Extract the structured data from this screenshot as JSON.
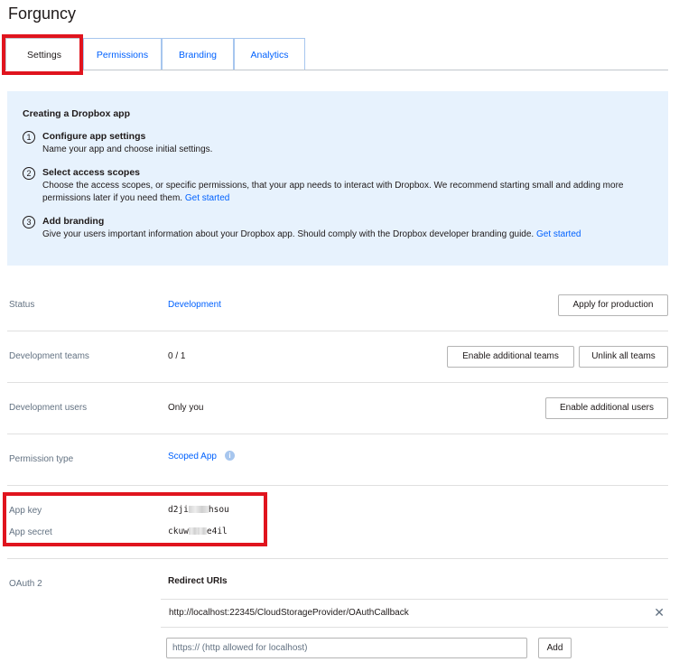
{
  "app": {
    "title": "Forguncy"
  },
  "tabs": [
    {
      "label": "Settings",
      "active": true
    },
    {
      "label": "Permissions",
      "active": false
    },
    {
      "label": "Branding",
      "active": false
    },
    {
      "label": "Analytics",
      "active": false
    }
  ],
  "info": {
    "title": "Creating a Dropbox app",
    "steps": [
      {
        "num": "1",
        "heading": "Configure app settings",
        "text": "Name your app and choose initial settings.",
        "link": ""
      },
      {
        "num": "2",
        "heading": "Select access scopes",
        "text": "Choose the access scopes, or specific permissions, that your app needs to interact with Dropbox. We recommend starting small and adding more permissions later if you need them.",
        "link": "Get started"
      },
      {
        "num": "3",
        "heading": "Add branding",
        "text": "Give your users important information about your Dropbox app. Should comply with the Dropbox developer branding guide.",
        "link": "Get started"
      }
    ]
  },
  "settings": {
    "status": {
      "label": "Status",
      "value": "Development",
      "button": "Apply for production"
    },
    "dev_teams": {
      "label": "Development teams",
      "value": "0 / 1",
      "button_enable": "Enable additional teams",
      "button_unlink": "Unlink all teams"
    },
    "dev_users": {
      "label": "Development users",
      "value": "Only you",
      "button": "Enable additional users"
    },
    "permission_type": {
      "label": "Permission type",
      "value": "Scoped App",
      "icon": "info-icon"
    },
    "app_key": {
      "label": "App key",
      "prefix": "d2ji",
      "suffix": "hsou"
    },
    "app_secret": {
      "label": "App secret",
      "prefix": "ckuw",
      "suffix": "e4il"
    },
    "oauth": {
      "label": "OAuth 2",
      "redirect_title": "Redirect URIs",
      "redirect_uris": [
        "http://localhost:22345/CloudStorageProvider/OAuthCallback"
      ],
      "input_placeholder": "https:// (http allowed for localhost)",
      "add_button": "Add"
    }
  },
  "colors": {
    "link": "#0061fe",
    "highlight": "#e0141e",
    "info_bg": "#e7f2fd"
  }
}
